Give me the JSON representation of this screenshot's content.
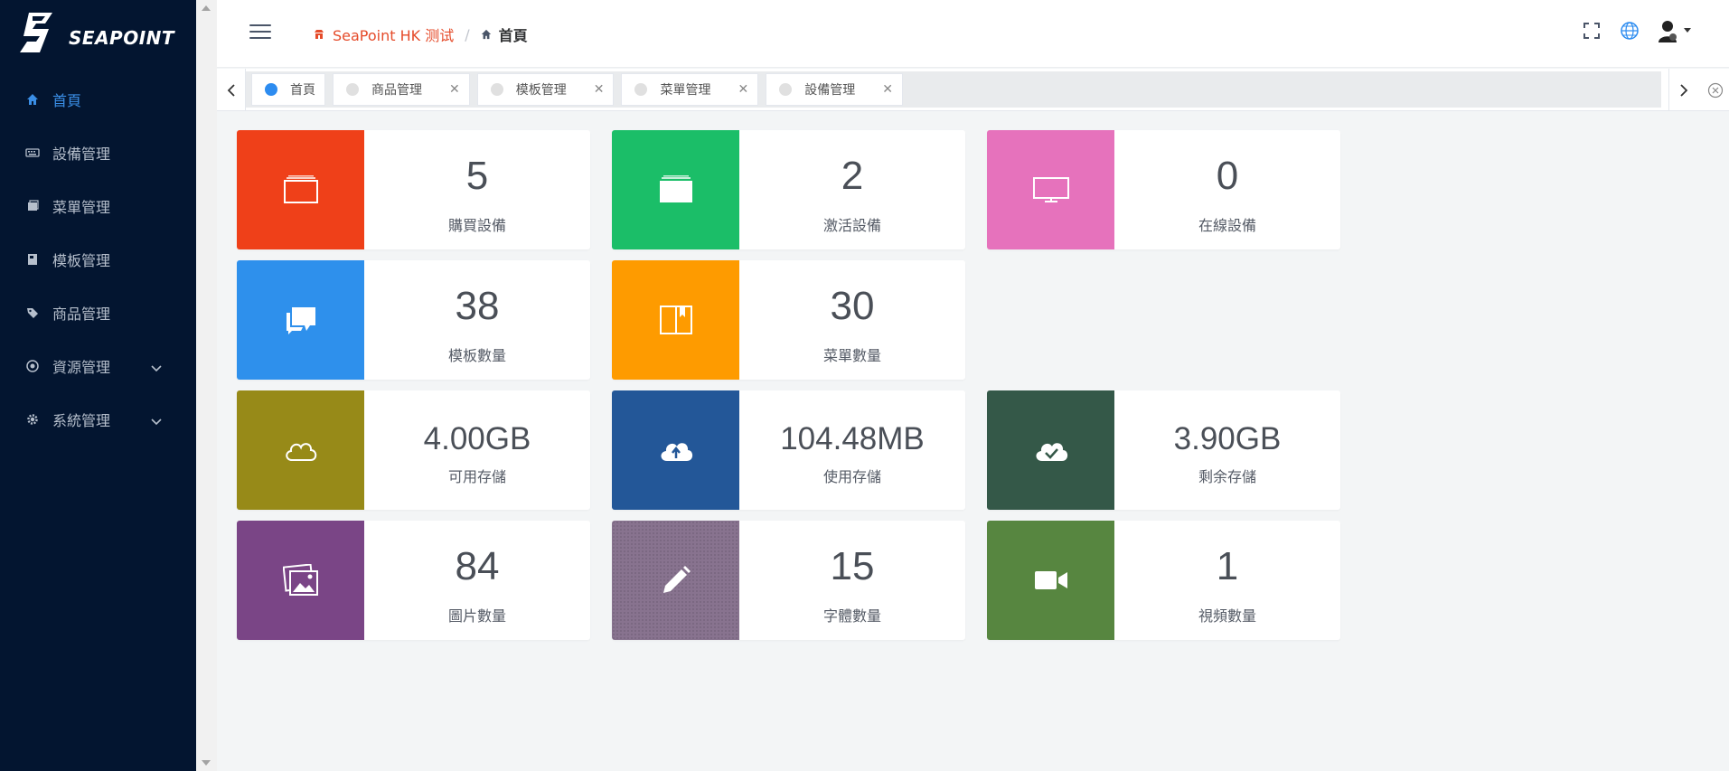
{
  "brand": {
    "name": "SEAPOINT"
  },
  "sidebar": {
    "items": [
      {
        "label": "首頁",
        "icon": "home-icon",
        "active": true
      },
      {
        "label": "設備管理",
        "icon": "keyboard-icon"
      },
      {
        "label": "菜單管理",
        "icon": "menu-book-icon"
      },
      {
        "label": "模板管理",
        "icon": "template-icon"
      },
      {
        "label": "商品管理",
        "icon": "tag-icon"
      },
      {
        "label": "資源管理",
        "icon": "settings-circle-icon",
        "expandable": true
      },
      {
        "label": "系統管理",
        "icon": "gear-icon",
        "expandable": true
      }
    ]
  },
  "header": {
    "breadcrumb": {
      "home": "SeaPoint HK 测试",
      "current": "首頁"
    }
  },
  "tabs": [
    {
      "label": "首頁",
      "active": true,
      "closable": false
    },
    {
      "label": "商品管理",
      "closable": true
    },
    {
      "label": "模板管理",
      "closable": true
    },
    {
      "label": "菜單管理",
      "closable": true
    },
    {
      "label": "設備管理",
      "closable": true
    }
  ],
  "tab_close_glyph": "✕",
  "cards": [
    {
      "value": "5",
      "label": "購買設備",
      "color": "#ef4019",
      "icon": "stack-window-icon"
    },
    {
      "value": "2",
      "label": "激活設備",
      "color": "#1bbe68",
      "icon": "stack-folder-icon"
    },
    {
      "value": "0",
      "label": "在線設備",
      "color": "#e672bc",
      "icon": "monitor-icon"
    },
    {
      "value": "38",
      "label": "模板數量",
      "color": "#2e90ec",
      "icon": "chat-bubbles-icon"
    },
    {
      "value": "30",
      "label": "菜單數量",
      "color": "#fe9b00",
      "icon": "book-icon"
    },
    {
      "value": "4.00GB",
      "label": "可用存儲",
      "color": "#978a18",
      "icon": "cloud-icon"
    },
    {
      "value": "104.48MB",
      "label": "使用存儲",
      "color": "#235798",
      "icon": "cloud-upload-icon"
    },
    {
      "value": "3.90GB",
      "label": "剩余存儲",
      "color": "#345848",
      "icon": "cloud-check-icon"
    },
    {
      "value": "84",
      "label": "圖片數量",
      "color": "#7a4586",
      "icon": "images-icon"
    },
    {
      "value": "15",
      "label": "字體數量",
      "color": "#88738f",
      "icon": "pencil-icon"
    },
    {
      "value": "1",
      "label": "視頻數量",
      "color": "#578640",
      "icon": "video-camera-icon"
    }
  ]
}
